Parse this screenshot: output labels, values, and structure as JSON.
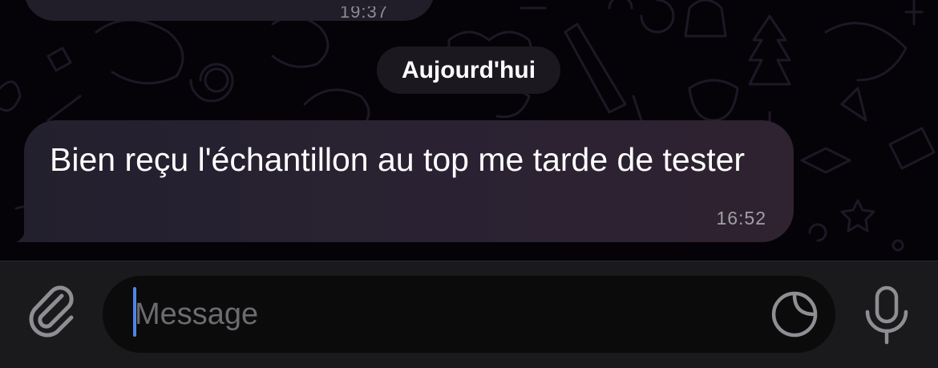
{
  "chat": {
    "previous_message_time": "19:37",
    "date_separator": "Aujourd'hui",
    "message": {
      "text": "Bien reçu l'échantillon au top me tarde de tester",
      "time": "16:52"
    }
  },
  "composer": {
    "placeholder": "Message",
    "value": ""
  },
  "icons": {
    "attach": "paperclip-icon",
    "sticker": "sticker-icon",
    "mic": "microphone-icon"
  },
  "colors": {
    "bubble": "#2a2232",
    "caret": "#4e86e6",
    "input_bar": "#1a1a1c",
    "placeholder": "#6c6c70"
  }
}
